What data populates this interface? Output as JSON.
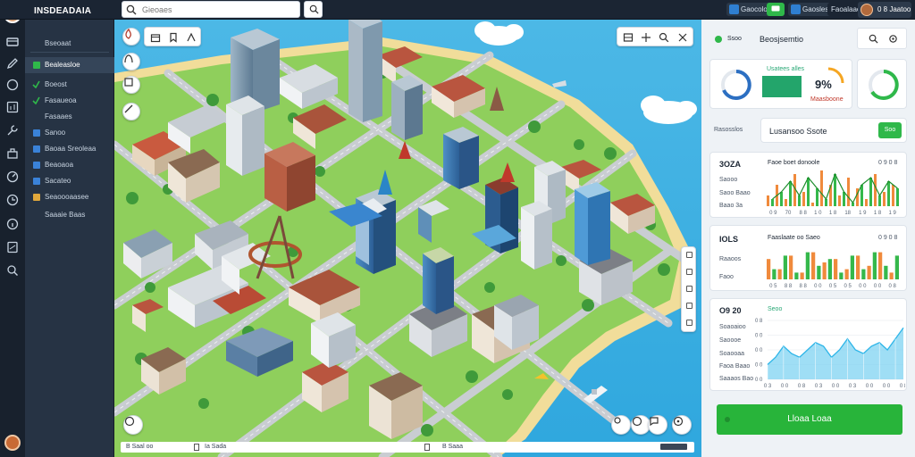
{
  "brand": "INSDEADAIA",
  "search": {
    "placeholder": "Gieoaes"
  },
  "top_chips": [
    {
      "label": "Gaocolol",
      "color": "#2f7fd1"
    },
    {
      "label": "",
      "color": "#2fb84a"
    },
    {
      "label": "Gaosles",
      "color": "#2f7fd1"
    },
    {
      "label": "Faoalaao",
      "color": "#324255"
    }
  ],
  "user": {
    "label": "0 8 Jaatoo"
  },
  "nav": {
    "items": [
      {
        "label": "Bseoaat",
        "marker": "none",
        "active": false
      },
      {
        "label": "Bealeasloe",
        "marker": "#2fb84a",
        "active": true
      },
      {
        "label": "Boeost",
        "marker": "check",
        "active": false
      },
      {
        "label": "Fasaueoa",
        "marker": "check",
        "active": false
      },
      {
        "label": "Fasaaes",
        "marker": "none",
        "active": false
      },
      {
        "label": "Sanoo",
        "marker": "#3a82d8",
        "active": false
      },
      {
        "label": "Baoaa Sreoleaa",
        "marker": "#3a82d8",
        "active": false
      },
      {
        "label": "Beaoaoa",
        "marker": "#3a82d8",
        "active": false
      },
      {
        "label": "Sacateo",
        "marker": "#3a82d8",
        "active": false
      },
      {
        "label": "Seaoooaasee",
        "marker": "#e0a83c",
        "active": false
      },
      {
        "label": "Saaaie Baas",
        "marker": "none",
        "active": false
      }
    ]
  },
  "map": {
    "status": [
      "B Saal oo",
      "Ia Sada",
      "B Saaa"
    ]
  },
  "right": {
    "header": {
      "label": "Ssoo",
      "title": "Beosjsemtio"
    },
    "stats": {
      "k1": "Usatees alles",
      "k2": "9%",
      "k2_sub": "Maasboone"
    },
    "tabs": {
      "left": "Rasosslos",
      "title": "Lusansoo Ssote",
      "badge": "Soo"
    },
    "chart1": {
      "value": "3OZA",
      "title": "Faoe boet donoole",
      "corner": "0 9 0 8",
      "rows": [
        "Saooo",
        "Saoo Baao",
        "Baao 3a"
      ]
    },
    "chart2": {
      "value": "IOLS",
      "title": "Faaslaate oo Saeo",
      "corner": "0 9 0 8",
      "rows": [
        "Raaoos",
        "Faoo"
      ]
    },
    "chart3": {
      "value": "O9 20",
      "title": "Seoo",
      "rows": [
        "Soaoaioo",
        "Saoooe",
        "Soaooaa",
        "Faoa Baao",
        "Saaaos Bao"
      ]
    },
    "cta": "Lloaa Loaa"
  },
  "chart_data": [
    {
      "type": "bar",
      "title": "Faoe boet donoole",
      "series": [
        {
          "values": [
            3,
            6,
            2,
            9,
            4,
            1,
            10,
            6,
            3,
            8,
            5,
            2,
            9,
            4,
            6
          ],
          "color": "#f08a3c"
        },
        {
          "values": [
            2,
            4,
            7,
            3,
            8,
            5,
            2,
            9,
            4,
            1,
            6,
            8,
            3,
            7,
            5
          ],
          "color": "#35b84b"
        }
      ],
      "ylim": [
        0,
        10
      ],
      "xlabels": [
        "0 9",
        "70",
        "8 8",
        "1 0",
        "1 8",
        "18",
        "1 9",
        "1 8",
        "1 9"
      ]
    },
    {
      "type": "bar",
      "title": "Faaslaate oo Saeo",
      "series": [
        {
          "values": [
            6,
            3,
            7,
            2,
            8,
            5,
            6,
            3,
            7,
            4,
            8,
            2
          ],
          "color": "#f08a3c"
        },
        {
          "values": [
            3,
            7,
            2,
            8,
            4,
            6,
            2,
            7,
            3,
            8,
            4,
            7
          ],
          "color": "#35b84b"
        }
      ],
      "ylim": [
        0,
        10
      ],
      "xlabels": [
        "0 5",
        "8 8",
        "8 8",
        "0 0",
        "0 5",
        "0 5",
        "0 0",
        "0 0",
        "0 8"
      ]
    },
    {
      "type": "area",
      "title": "Seoo",
      "x": [
        0,
        1,
        2,
        3,
        4,
        5,
        6,
        7,
        8,
        9,
        10,
        11,
        12,
        13,
        14,
        15,
        16,
        17
      ],
      "series": [
        {
          "values": [
            2,
            3,
            4.5,
            3.5,
            3,
            4,
            5,
            4.5,
            3,
            4,
            5.5,
            4,
            3.5,
            4.5,
            5,
            4,
            5.5,
            7
          ],
          "color": "#2db5e8"
        }
      ],
      "ylim": [
        0,
        8
      ],
      "xlabels": [
        "0 3",
        "0 0",
        "0 8",
        "0 3",
        "0 0",
        "0 3",
        "0 0",
        "0 0",
        "0 8"
      ],
      "ylabels": [
        "0 0",
        "0 0",
        "0 0",
        "0 0",
        "0 8"
      ]
    }
  ]
}
